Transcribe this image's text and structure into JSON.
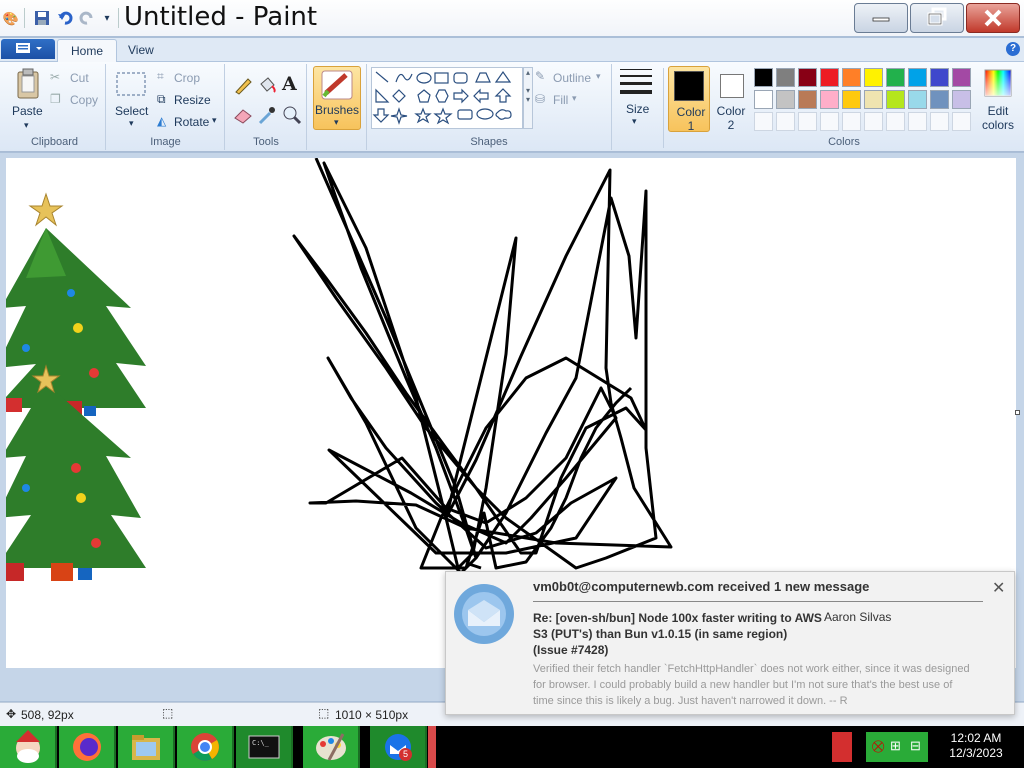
{
  "window": {
    "title": "Untitled - Paint"
  },
  "tabs": [
    {
      "label": "Home"
    },
    {
      "label": "View"
    }
  ],
  "ribbon": {
    "clipboard": {
      "paste": "Paste",
      "cut": "Cut",
      "copy": "Copy",
      "group": "Clipboard"
    },
    "image": {
      "select": "Select",
      "crop": "Crop",
      "resize": "Resize",
      "rotate": "Rotate",
      "group": "Image"
    },
    "tools": {
      "group": "Tools"
    },
    "brushes": {
      "label": "Brushes"
    },
    "shapes": {
      "outline": "Outline",
      "fill": "Fill",
      "group": "Shapes"
    },
    "size": {
      "label": "Size"
    },
    "colors": {
      "color1": "Color 1",
      "color1_value": "#000000",
      "color2": "Color 2",
      "color2_value": "#ffffff",
      "edit": "Edit colors",
      "group": "Colors",
      "palette": [
        "#000000",
        "#7f7f7f",
        "#880015",
        "#ed1c24",
        "#ff7f27",
        "#fff200",
        "#22b14c",
        "#00a2e8",
        "#3f48cc",
        "#a349a4",
        "#ffffff",
        "#c3c3c3",
        "#b97a57",
        "#ffaec9",
        "#ffc90e",
        "#efe4b0",
        "#b5e61d",
        "#99d9ea",
        "#7092be",
        "#c8bfe7"
      ]
    }
  },
  "status": {
    "cursor": "508, 92px",
    "canvas_size": "1010 × 510px"
  },
  "notification": {
    "header": "vm0b0t@computernewb.com received 1 new message",
    "subject": "Re: [oven-sh/bun] Node 100x faster writing to AWS S3 (PUT's) than Bun v1.0.15 (in same region) (Issue #7428)",
    "sender": "Aaron Silvas",
    "body": "Verified their fetch handler `FetchHttpHandler` does not work either, since it was designed for browser. I could probably build a new handler but I'm not sure that's the best use of time since this is likely a bug. Just haven't narrowed it down. -- R"
  },
  "taskbar": {
    "items": [
      "santa-icon",
      "firefox-icon",
      "file-manager-icon",
      "chrome-icon",
      "terminal-icon",
      "paint-icon",
      "thunderbird-icon"
    ],
    "thunderbird_badge": "5",
    "time": "12:02 AM",
    "date": "12/3/2023"
  }
}
